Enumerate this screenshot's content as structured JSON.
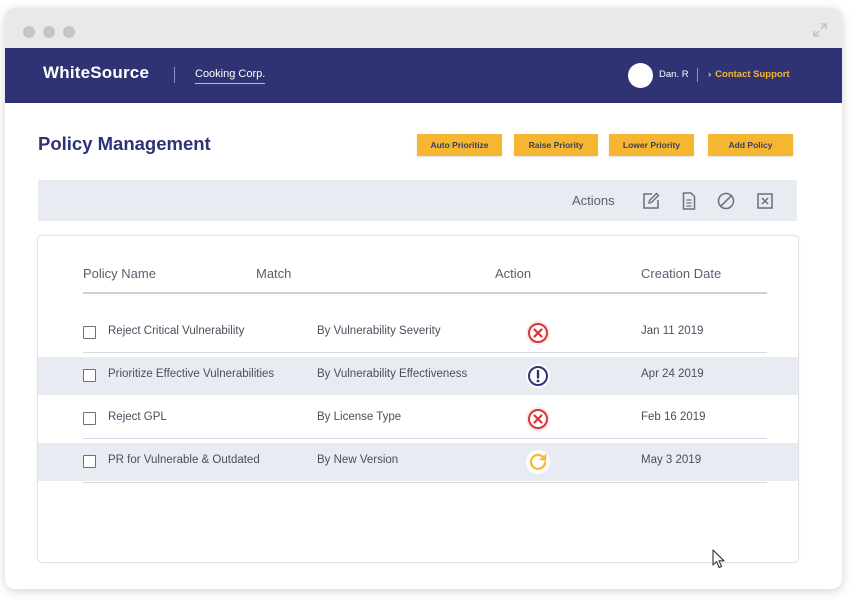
{
  "header": {
    "logo": "WhiteSource",
    "org": "Cooking Corp.",
    "user": "Dan. R",
    "support_link": "Contact Support"
  },
  "page": {
    "title": "Policy Management",
    "buttons": {
      "auto_prioritize": "Auto Prioritize",
      "raise_priority": "Raise Priority",
      "lower_priority": "Lower Priority",
      "add_policy": "Add Policy"
    },
    "actions_label": "Actions",
    "action_icons": [
      "edit-icon",
      "document-icon",
      "disable-icon",
      "delete-icon"
    ]
  },
  "table": {
    "columns": [
      "Policy Name",
      "Match",
      "Action",
      "Creation Date"
    ],
    "rows": [
      {
        "name": "Reject Critical Vulnerability",
        "match": "By Vulnerability Severity",
        "action": "reject",
        "action_icon": "reject-icon",
        "date": "Jan 11 2019"
      },
      {
        "name": "Prioritize Effective Vulnerabilities",
        "match": "By Vulnerability Effectiveness",
        "action": "prioritize",
        "action_icon": "alert-icon",
        "date": "Apr 24 2019"
      },
      {
        "name": "Reject GPL",
        "match": "By License Type",
        "action": "reject",
        "action_icon": "reject-icon",
        "date": "Feb 16 2019"
      },
      {
        "name": "PR for Vulnerable & Outdated",
        "match": "By New Version",
        "action": "pull-request",
        "action_icon": "refresh-icon",
        "date": "May 3 2019"
      }
    ]
  },
  "colors": {
    "navbar": "#2f3374",
    "accent": "#f5b731",
    "reject": "#d9343a",
    "prioritize": "#2f3374",
    "pull_request": "#f5b731"
  }
}
